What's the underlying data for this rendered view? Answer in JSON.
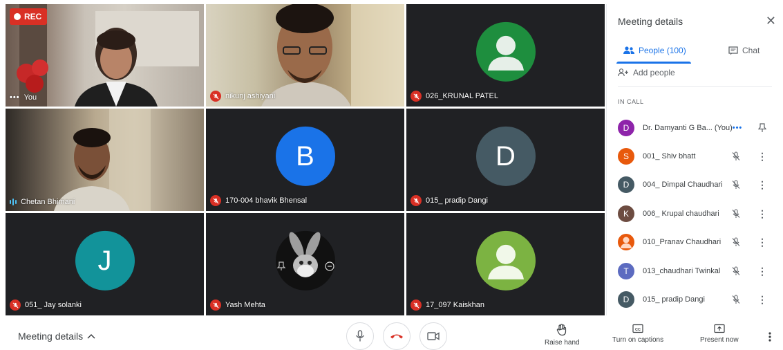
{
  "grid": {
    "rec_label": "REC",
    "tiles": [
      {
        "name": "You",
        "kind": "video"
      },
      {
        "name": "nikunj ashiyani",
        "kind": "video"
      },
      {
        "name": "026_KRUNAL PATEL",
        "kind": "generic-avatar",
        "avatar_color": "#1e8e3e"
      },
      {
        "name": "Chetan Bhimani",
        "kind": "video"
      },
      {
        "name": "170-004 bhavik Bhensal",
        "kind": "letter",
        "letter": "B",
        "avatar_color": "#1a73e8"
      },
      {
        "name": "015_ pradip Dangi",
        "kind": "letter",
        "letter": "D",
        "avatar_color": "#455a64"
      },
      {
        "name": "051_ Jay solanki",
        "kind": "letter",
        "letter": "J",
        "avatar_color": "#12939a"
      },
      {
        "name": "Yash Mehta",
        "kind": "image-avatar"
      },
      {
        "name": "17_097 Kaiskhan",
        "kind": "generic-avatar",
        "avatar_color": "#7cb342"
      }
    ]
  },
  "panel": {
    "title": "Meeting details",
    "tabs": {
      "people": "People (100)",
      "chat": "Chat"
    },
    "add_people": "Add people",
    "section": "IN CALL",
    "participants": [
      {
        "initial": "D",
        "name": "Dr. Damyanti G Ba... (You)",
        "color": "#8e24aa"
      },
      {
        "initial": "S",
        "name": "001_ Shiv bhatt",
        "color": "#e8590c"
      },
      {
        "initial": "D",
        "name": "004_ Dimpal Chaudhari",
        "color": "#455a64"
      },
      {
        "initial": "K",
        "name": "006_ Krupal chaudhari",
        "color": "#6d4c41"
      },
      {
        "initial": "",
        "name": "010_Pranav Chaudhari",
        "color": "#e8590c"
      },
      {
        "initial": "T",
        "name": "013_chaudhari Twinkal",
        "color": "#5c6bc0"
      },
      {
        "initial": "D",
        "name": "015_ pradip Dangi",
        "color": "#455a64"
      }
    ]
  },
  "bottom": {
    "meeting_details": "Meeting details",
    "raise_hand": "Raise hand",
    "captions": "Turn on captions",
    "present": "Present now",
    "icons": [
      "mic-icon",
      "hangup-icon",
      "camera-icon",
      "hand-icon",
      "captions-icon",
      "present-icon",
      "more-icon"
    ]
  }
}
